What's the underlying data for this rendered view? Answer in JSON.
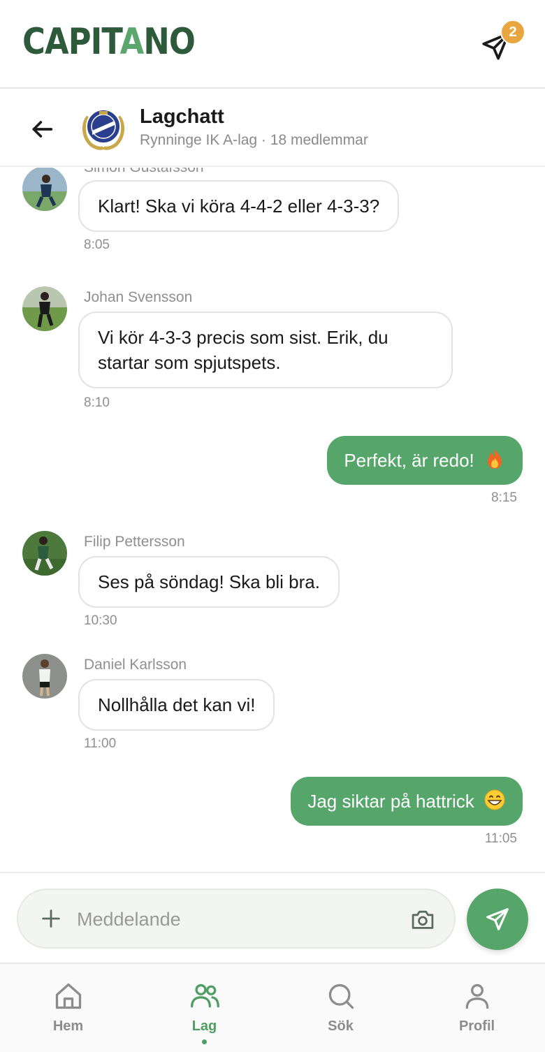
{
  "app": {
    "logo_part1": "CAPIT",
    "logo_part2": "A",
    "logo_part3": "NO",
    "notification_count": "2"
  },
  "chat": {
    "title": "Lagchatt",
    "subtitle": "Rynninge IK A-lag · 18 medlemmar"
  },
  "messages": [
    {
      "direction": "in",
      "sender": "Simon Gustafsson",
      "text": "Klart! Ska vi köra 4-4-2 eller 4-3-3?",
      "time": "8:05"
    },
    {
      "direction": "in",
      "sender": "Johan Svensson",
      "text": "Vi kör 4-3-3 precis som sist. Erik, du startar som spjutspets.",
      "time": "8:10"
    },
    {
      "direction": "out",
      "text": "Perfekt, är redo!",
      "emoji": "fire-emoji",
      "time": "8:15"
    },
    {
      "direction": "in",
      "sender": "Filip Pettersson",
      "text": "Ses på söndag! Ska bli bra.",
      "time": "10:30"
    },
    {
      "direction": "in",
      "sender": "Daniel Karlsson",
      "text": "Nollhålla det kan vi!",
      "time": "11:00"
    },
    {
      "direction": "out",
      "text": "Jag siktar på hattrick",
      "emoji": "grinning-emoji",
      "time": "11:05"
    }
  ],
  "composer": {
    "placeholder": "Meddelande"
  },
  "tabs": [
    {
      "label": "Hem",
      "icon": "home-icon",
      "active": false
    },
    {
      "label": "Lag",
      "icon": "team-icon",
      "active": true
    },
    {
      "label": "Sök",
      "icon": "search-icon",
      "active": false
    },
    {
      "label": "Profil",
      "icon": "profile-icon",
      "active": false
    }
  ],
  "colors": {
    "brand_dark": "#2d5a3a",
    "accent_green": "#56a56a",
    "badge_orange": "#e8a640"
  }
}
